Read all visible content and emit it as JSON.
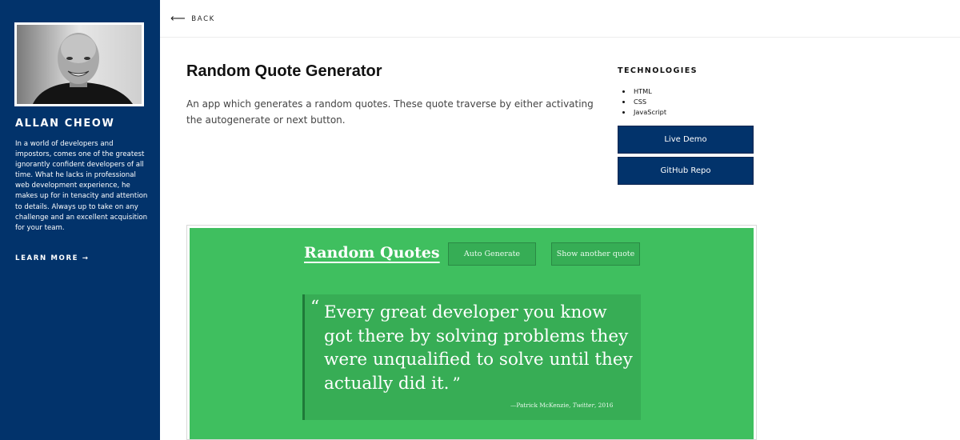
{
  "sidebar": {
    "name": "ALLAN CHEOW",
    "bio": "In a world of developers and impostors, comes one of the greatest ignorantly confident developers of all time. What he lacks in professional web development experience, he makes up for in tenacity and attention to details. Always up to take on any challenge and an excellent acquisition for your team.",
    "learn_more": "LEARN MORE →",
    "colors": {
      "background": "#02336b"
    }
  },
  "topbar": {
    "back_icon": "arrow-left-icon",
    "back_label": "BACK"
  },
  "project": {
    "title": "Random Quote Generator",
    "description": "An app which generates a random quotes. These quote traverse by either activating the autogenerate or next button.",
    "technologies_heading": "TECHNOLOGIES",
    "technologies": [
      "HTML",
      "CSS",
      "JavaScript"
    ],
    "live_demo_label": "Live Demo",
    "github_label": "GitHub Repo"
  },
  "preview": {
    "colors": {
      "background": "#3fbf5f",
      "quote_box": "#37ad55"
    },
    "app_title": "Random Quotes",
    "auto_generate_label": "Auto Generate",
    "next_quote_label": "Show another quote",
    "quote_open": "“",
    "quote": "Every great developer you know got there by solving problems they were unqualified to solve until they actually did it.",
    "quote_close": "”",
    "cite_author": "—Patrick McKenzie,",
    "cite_source": "Twitter",
    "cite_year": ", 2016"
  }
}
